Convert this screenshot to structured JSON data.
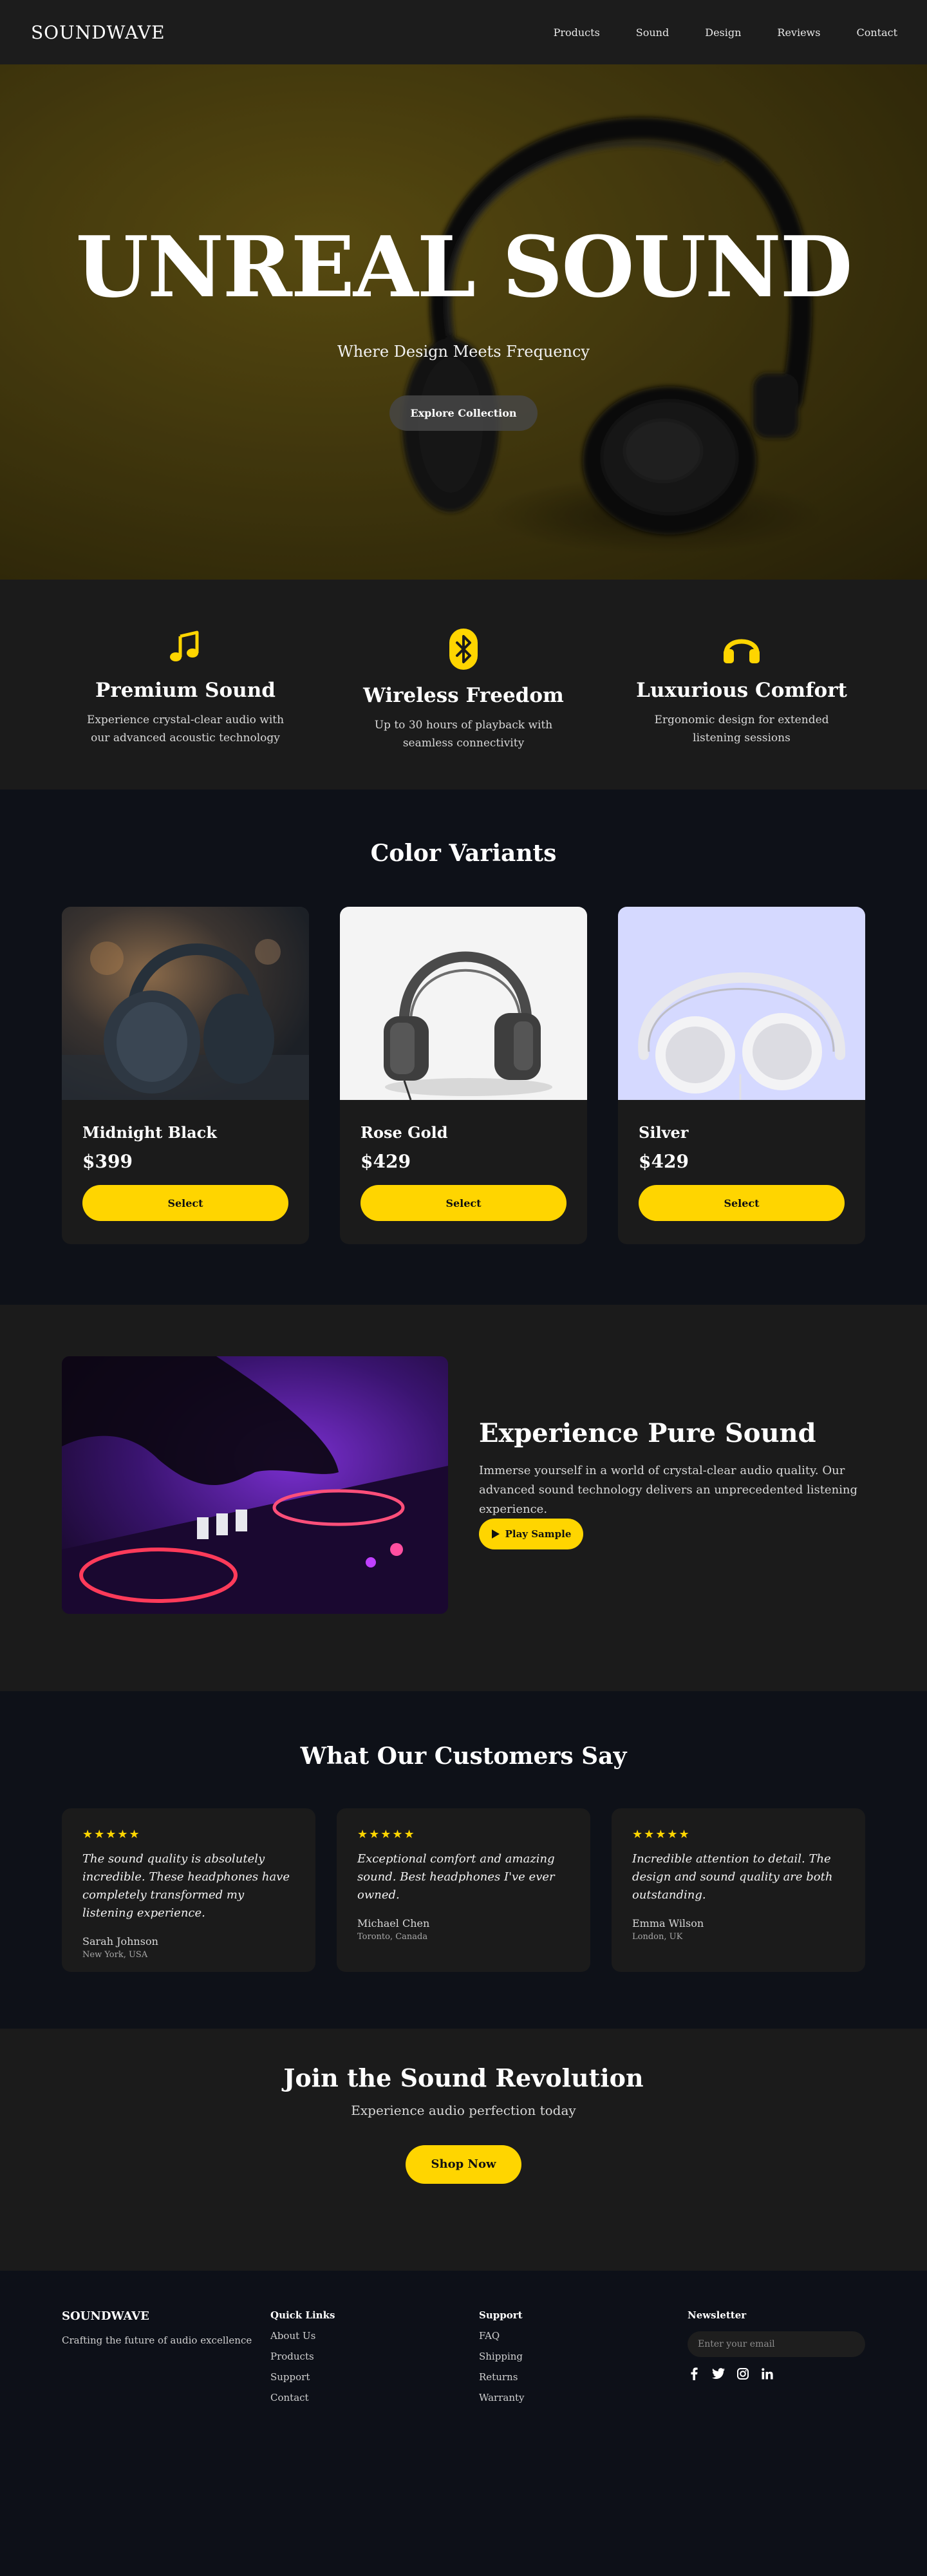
{
  "nav": {
    "logo": "SOUNDWAVE",
    "links": [
      "Products",
      "Sound",
      "Design",
      "Reviews",
      "Contact"
    ]
  },
  "hero": {
    "title": "UNREAL SOUND",
    "subtitle": "Where Design Meets Frequency",
    "button": "Explore Collection"
  },
  "features": [
    {
      "icon": "music-note-icon",
      "title": "Premium Sound",
      "text": "Experience crystal-clear audio with our advanced acoustic technology"
    },
    {
      "icon": "bluetooth-icon",
      "title": "Wireless Freedom",
      "text": "Up to 30 hours of playback with seamless connectivity"
    },
    {
      "icon": "headphones-icon",
      "title": "Luxurious Comfort",
      "text": "Ergonomic design for extended listening sessions"
    }
  ],
  "variants": {
    "title": "Color Variants",
    "items": [
      {
        "name": "Midnight Black",
        "price": "$399",
        "button": "Select"
      },
      {
        "name": "Rose Gold",
        "price": "$429",
        "button": "Select"
      },
      {
        "name": "Silver",
        "price": "$429",
        "button": "Select"
      }
    ]
  },
  "experience": {
    "title": "Experience Pure Sound",
    "text": "Immerse yourself in a world of crystal-clear audio quality. Our advanced sound technology delivers an unprecedented listening experience.",
    "button": "Play Sample"
  },
  "testimonials": {
    "title": "What Our Customers Say",
    "items": [
      {
        "stars": "★★★★★",
        "quote": "The sound quality is absolutely incredible. These headphones have completely transformed my listening experience.",
        "name": "Sarah Johnson",
        "location": "New York, USA"
      },
      {
        "stars": "★★★★★",
        "quote": "Exceptional comfort and amazing sound. Best headphones I've ever owned.",
        "name": "Michael Chen",
        "location": "Toronto, Canada"
      },
      {
        "stars": "★★★★★",
        "quote": "Incredible attention to detail. The design and sound quality are both outstanding.",
        "name": "Emma Wilson",
        "location": "London, UK"
      }
    ]
  },
  "cta": {
    "title": "Join the Sound Revolution",
    "subtitle": "Experience audio perfection today",
    "button": "Shop Now"
  },
  "footer": {
    "logo": "SOUNDWAVE",
    "tagline": "Crafting the future of audio excellence",
    "quick_links": {
      "heading": "Quick Links",
      "links": [
        "About Us",
        "Products",
        "Support",
        "Contact"
      ]
    },
    "support": {
      "heading": "Support",
      "links": [
        "FAQ",
        "Shipping",
        "Returns",
        "Warranty"
      ]
    },
    "newsletter": {
      "heading": "Newsletter",
      "placeholder": "Enter your email"
    },
    "social": [
      "facebook-icon",
      "twitter-icon",
      "instagram-icon",
      "linkedin-icon"
    ]
  },
  "colors": {
    "accent": "#ffd500",
    "dark": "#0e1118",
    "panel": "#1b1b1b"
  }
}
